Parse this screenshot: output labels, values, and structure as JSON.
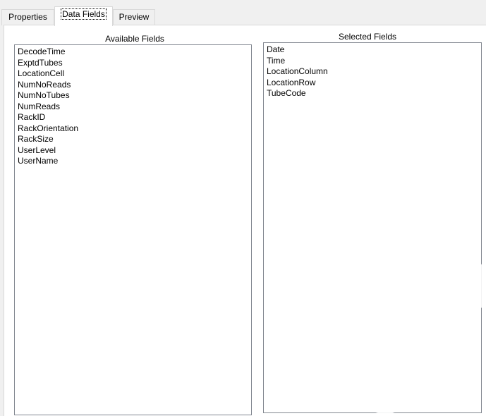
{
  "tabs": [
    {
      "label": "Properties",
      "active": false
    },
    {
      "label": "Data Fields",
      "active": true
    },
    {
      "label": "Preview",
      "active": false
    }
  ],
  "available": {
    "label": "Available Fields",
    "items": [
      "DecodeTime",
      "ExptdTubes",
      "LocationCell",
      "NumNoReads",
      "NumNoTubes",
      "NumReads",
      "RackID",
      "RackOrientation",
      "RackSize",
      "UserLevel",
      "UserName"
    ]
  },
  "selected": {
    "label": "Selected Fields",
    "items": [
      "Date",
      "Time",
      "LocationColumn",
      "LocationRow",
      "TubeCode"
    ]
  },
  "watermark": {
    "text": "DUT",
    "color": "#ffffff"
  }
}
